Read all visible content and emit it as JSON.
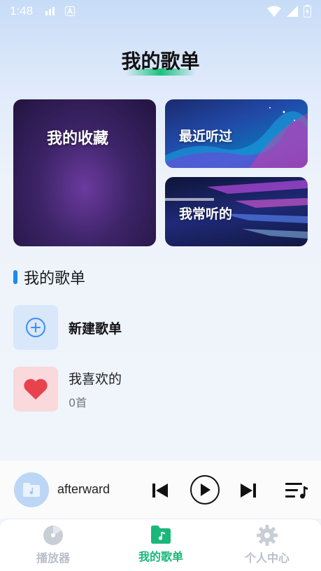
{
  "status_bar": {
    "time": "1:48",
    "icons": [
      "signal-strength-icon",
      "a-icon",
      "wifi-icon",
      "cell-signal-icon",
      "battery-icon"
    ]
  },
  "header": {
    "title": "我的歌单"
  },
  "cards": {
    "favorites": "我的收藏",
    "recent": "最近听过",
    "frequent": "我常听的"
  },
  "section": {
    "title": "我的歌单"
  },
  "playlists": {
    "new_label": "新建歌单",
    "liked": {
      "name": "我喜欢的",
      "count": "0首"
    }
  },
  "player": {
    "song": "afterward",
    "icons": [
      "previous-icon",
      "play-icon",
      "next-icon",
      "playlist-icon"
    ]
  },
  "tabs": [
    {
      "label": "播放器",
      "icon": "disc-icon",
      "active": false
    },
    {
      "label": "我的歌单",
      "icon": "music-folder-icon",
      "active": true
    },
    {
      "label": "个人中心",
      "icon": "gear-icon",
      "active": false
    }
  ],
  "colors": {
    "accent_green": "#18b87a",
    "accent_blue": "#1a8cf0",
    "heart_red": "#e8434d"
  }
}
